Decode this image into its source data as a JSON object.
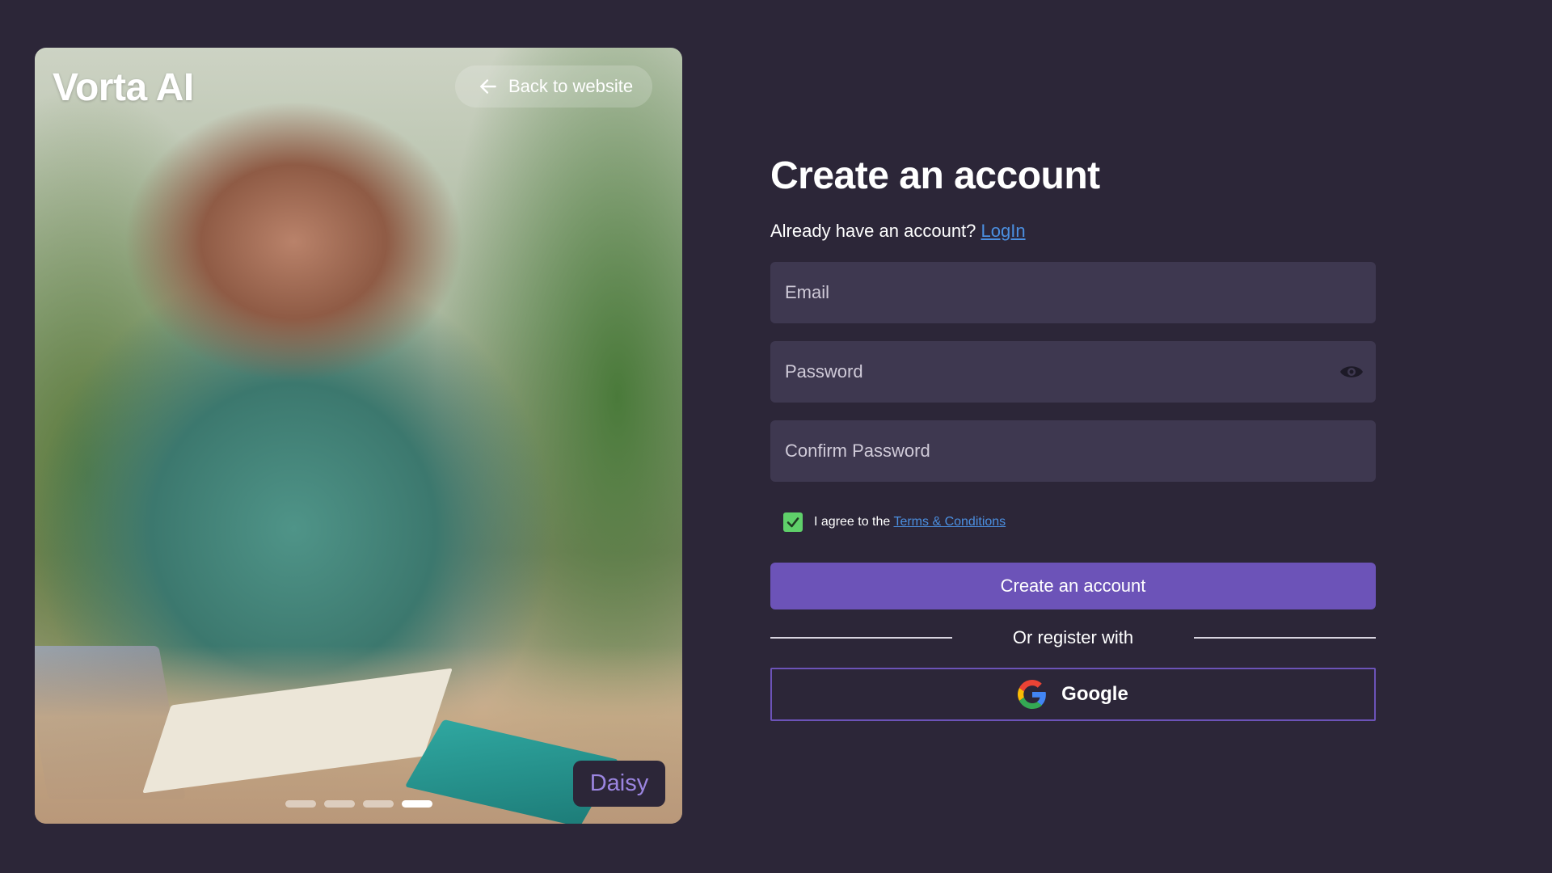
{
  "hero": {
    "brand": "Vorta AI",
    "back_label": "Back to website",
    "character_name": "Daisy",
    "slide_count": 4,
    "active_slide": 4
  },
  "form": {
    "title": "Create an account",
    "subtitle_text": "Already have an account? ",
    "login_link": "LogIn",
    "email_placeholder": "Email",
    "password_placeholder": "Password",
    "confirm_placeholder": "Confirm Password",
    "agree_text": "I agree to the ",
    "terms_link": "Terms & Conditions",
    "agree_checked": true,
    "submit_label": "Create an account",
    "divider_label": "Or register with",
    "google_label": "Google"
  },
  "colors": {
    "background": "#2c2638",
    "field": "#3e3850",
    "accent": "#6c53b8",
    "link": "#4b8fe0",
    "checkbox": "#5fd06a"
  },
  "icons": {
    "back": "arrow-left-icon",
    "password_toggle": "eye-icon",
    "checkbox": "check-icon",
    "google": "google-icon"
  }
}
